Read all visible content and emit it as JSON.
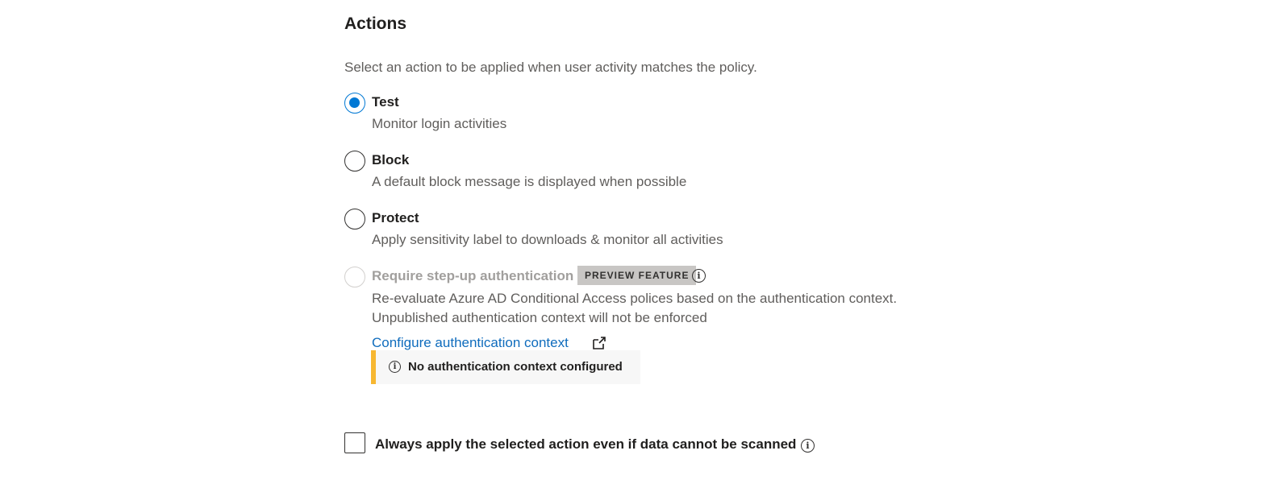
{
  "section": {
    "title": "Actions",
    "description": "Select an action to be applied when user activity matches the policy."
  },
  "options": [
    {
      "label": "Test",
      "description": "Monitor login activities",
      "selected": true,
      "disabled": false
    },
    {
      "label": "Block",
      "description": "A default block message is displayed when possible",
      "selected": false,
      "disabled": false
    },
    {
      "label": "Protect",
      "description": "Apply sensitivity label to downloads & monitor all activities",
      "selected": false,
      "disabled": false
    },
    {
      "label": "Require step-up authentication",
      "badge": "PREVIEW FEATURE",
      "description_line1": "Re-evaluate Azure AD Conditional Access polices based on the authentication context.",
      "description_line2": "Unpublished authentication context will not be enforced",
      "link": "Configure authentication context",
      "notice": "No authentication context configured",
      "selected": false,
      "disabled": true
    }
  ],
  "always_apply": {
    "label": "Always apply the selected action even if data cannot be scanned",
    "checked": false
  },
  "icons": {
    "info": "info-icon",
    "external_link": "external-link-icon"
  },
  "colors": {
    "accent": "#0078d4",
    "link": "#0f6cbd",
    "warning": "#f7b731",
    "badge_bg": "#c8c6c4"
  }
}
